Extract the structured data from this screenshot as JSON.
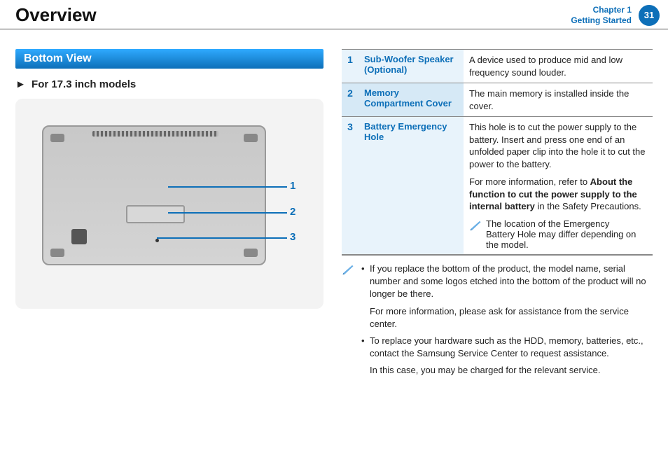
{
  "header": {
    "title": "Overview",
    "chapter_line1": "Chapter 1",
    "chapter_line2": "Getting Started",
    "page_number": "31"
  },
  "left": {
    "section_title": "Bottom View",
    "subhead_arrow": "►",
    "subhead_text": "For 17.3 inch models",
    "callout1": "1",
    "callout2": "2",
    "callout3": "3"
  },
  "table": {
    "rows": [
      {
        "num": "1",
        "name": "Sub-Woofer Speaker (Optional)",
        "desc_plain": "A device used to produce mid and low frequency sound louder."
      },
      {
        "num": "2",
        "name": "Memory Compartment Cover",
        "desc_plain": "The main memory is installed inside the cover."
      },
      {
        "num": "3",
        "name": "Battery Emergency Hole",
        "desc_p1": "This hole is to cut the power supply to the battery. Insert and press one end of an unfolded paper clip into the hole it to cut the power to the battery.",
        "desc_p2_prefix": "For more information, refer to ",
        "desc_p2_bold": "About the function to cut the power supply to the internal battery",
        "desc_p2_suffix": " in the Safety Precautions.",
        "note_line1": "The location of the Emergency",
        "note_line2": "Battery Hole may differ depending on the model."
      }
    ]
  },
  "notes": {
    "item1_p1": "If you replace the bottom of the product, the model name, serial number and some logos etched into the bottom of the product will no longer be there.",
    "item1_p2": "For more information, please ask for assistance from the service center.",
    "item2_p1": "To replace your hardware such as the HDD, memory, batteries, etc., contact the Samsung Service Center to request assistance.",
    "item2_p2": "In this case, you may be charged for the relevant service."
  }
}
